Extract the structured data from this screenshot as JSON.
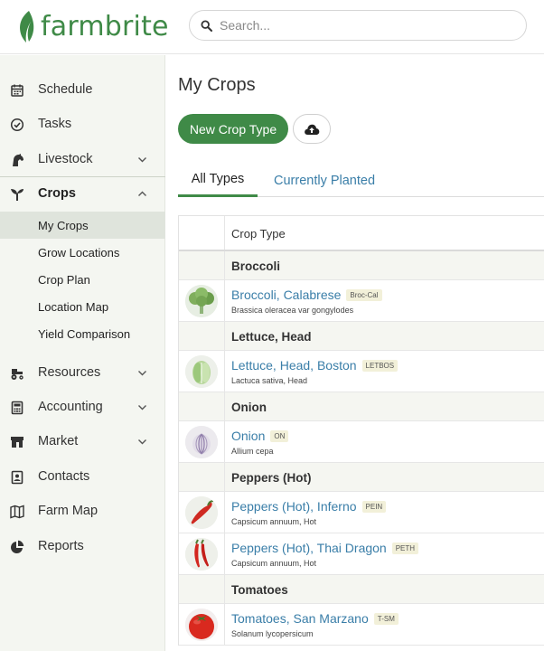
{
  "brand": {
    "name": "farmbrite",
    "color": "#3f8a47"
  },
  "search": {
    "placeholder": "Search..."
  },
  "sidebar": {
    "items": [
      {
        "label": "Schedule",
        "icon": "calendar-icon"
      },
      {
        "label": "Tasks",
        "icon": "check-circle-icon"
      },
      {
        "label": "Livestock",
        "icon": "horse-icon",
        "expandable": true
      },
      {
        "label": "Crops",
        "icon": "seedling-icon",
        "expandable": true,
        "expanded": true
      },
      {
        "label": "Resources",
        "icon": "tractor-icon",
        "expandable": true
      },
      {
        "label": "Accounting",
        "icon": "calculator-icon",
        "expandable": true
      },
      {
        "label": "Market",
        "icon": "store-icon",
        "expandable": true
      },
      {
        "label": "Contacts",
        "icon": "address-book-icon"
      },
      {
        "label": "Farm Map",
        "icon": "map-icon"
      },
      {
        "label": "Reports",
        "icon": "pie-chart-icon"
      }
    ],
    "crops_sub": [
      {
        "label": "My Crops",
        "selected": true
      },
      {
        "label": "Grow Locations"
      },
      {
        "label": "Crop Plan"
      },
      {
        "label": "Location Map"
      },
      {
        "label": "Yield Comparison"
      }
    ]
  },
  "main": {
    "title": "My Crops",
    "new_button": "New Crop Type",
    "tabs": [
      {
        "label": "All Types",
        "active": true
      },
      {
        "label": "Currently Planted"
      }
    ],
    "table": {
      "header": "Crop Type",
      "groups": [
        {
          "name": "Broccoli",
          "crops": [
            {
              "name": "Broccoli, Calabrese",
              "code": "Broc-Cal",
              "scientific": "Brassica oleracea var gongylodes",
              "thumb": "broccoli"
            }
          ]
        },
        {
          "name": "Lettuce, Head",
          "crops": [
            {
              "name": "Lettuce, Head, Boston",
              "code": "LETBOS",
              "scientific": "Lactuca sativa, Head",
              "thumb": "lettuce"
            }
          ]
        },
        {
          "name": "Onion",
          "crops": [
            {
              "name": "Onion",
              "code": "ON",
              "scientific": "Allium cepa",
              "thumb": "onion"
            }
          ]
        },
        {
          "name": "Peppers (Hot)",
          "crops": [
            {
              "name": "Peppers (Hot), Inferno",
              "code": "PEIN",
              "scientific": "Capsicum annuum, Hot",
              "thumb": "pepper1"
            },
            {
              "name": "Peppers (Hot), Thai Dragon",
              "code": "PETH",
              "scientific": "Capsicum annuum, Hot",
              "thumb": "pepper2"
            }
          ]
        },
        {
          "name": "Tomatoes",
          "crops": [
            {
              "name": "Tomatoes, San Marzano",
              "code": "T-SM",
              "scientific": "Solanum lycopersicum",
              "thumb": "tomato"
            }
          ]
        }
      ]
    }
  }
}
